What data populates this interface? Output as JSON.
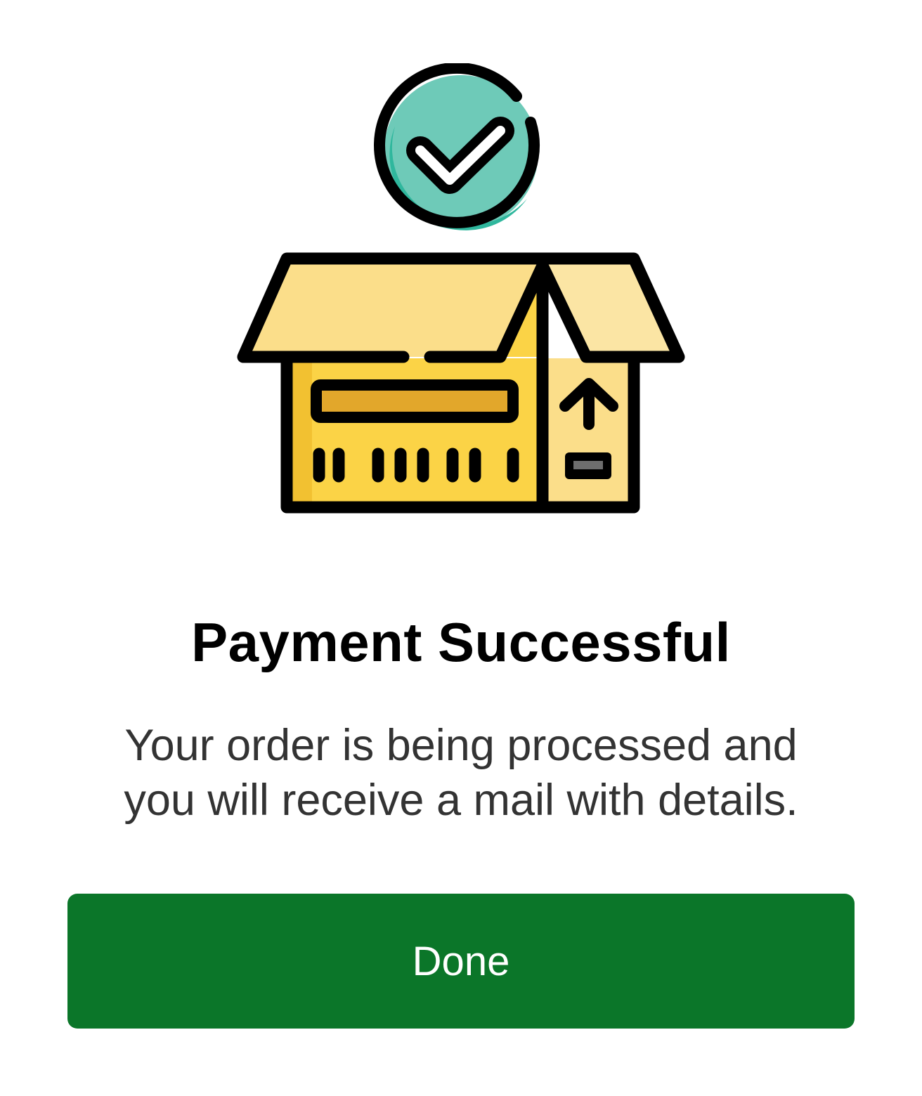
{
  "confirmation": {
    "title": "Payment Successful",
    "message_line1": "Your order is being processed and",
    "message_line2": "you will receive a mail with details."
  },
  "actions": {
    "done_label": "Done"
  },
  "illustration": {
    "icons": [
      "check-badge-icon",
      "open-box-icon"
    ]
  },
  "colors": {
    "button_bg": "#0b7629",
    "button_text": "#ffffff",
    "check_circle": "#6ecab8",
    "check_circle_shade": "#2fb79d",
    "box_front": "#fbd346",
    "box_flap": "#fbde8a",
    "box_label": "#e2a72b",
    "outline": "#000000"
  }
}
